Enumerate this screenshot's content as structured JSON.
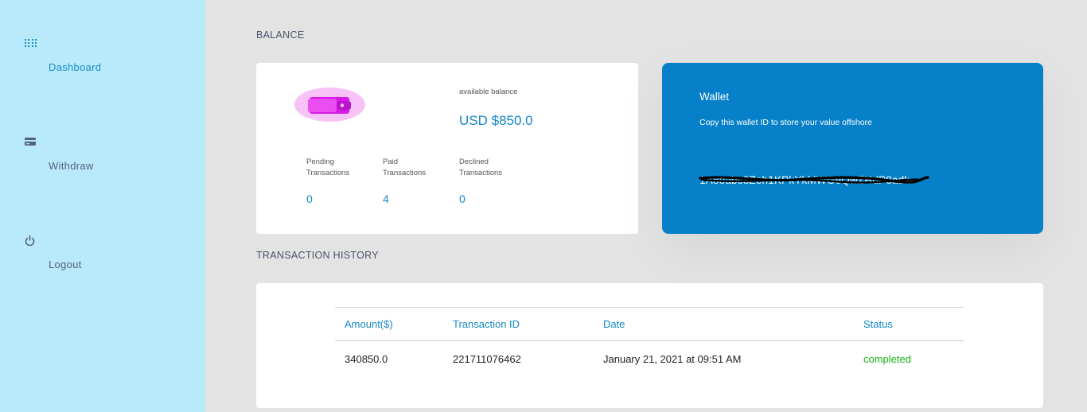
{
  "sidebar": {
    "items": [
      {
        "label": "Dashboard",
        "icon": "grid-dots-icon"
      },
      {
        "label": "Withdraw",
        "icon": "credit-card-icon"
      },
      {
        "label": "Logout",
        "icon": "power-icon"
      }
    ],
    "active_color": "#1a8fc6"
  },
  "balance": {
    "section_title": "BALANCE",
    "available_label": "available balance",
    "available_value": "USD $850.0",
    "stats": [
      {
        "label": "Pending Transactions",
        "value": "0"
      },
      {
        "label": "Paid Transactions",
        "value": "4"
      },
      {
        "label": "Declined Transactions",
        "value": "0"
      }
    ]
  },
  "wallet": {
    "title": "Wallet",
    "subtitle": "Copy this wallet ID to store your value offshore",
    "id_text": "1A8eabc8Zeh1KPkYkMWGeQwZHdP8adk",
    "background": "#0680c8"
  },
  "history": {
    "section_title": "TRANSACTION HISTORY",
    "columns": [
      "Amount($)",
      "Transaction ID",
      "Date",
      "Status"
    ],
    "rows": [
      {
        "amount": "340850.0",
        "transaction_id": "221711076462",
        "date": "January 21, 2021 at 09:51 AM",
        "status": "completed"
      }
    ]
  }
}
